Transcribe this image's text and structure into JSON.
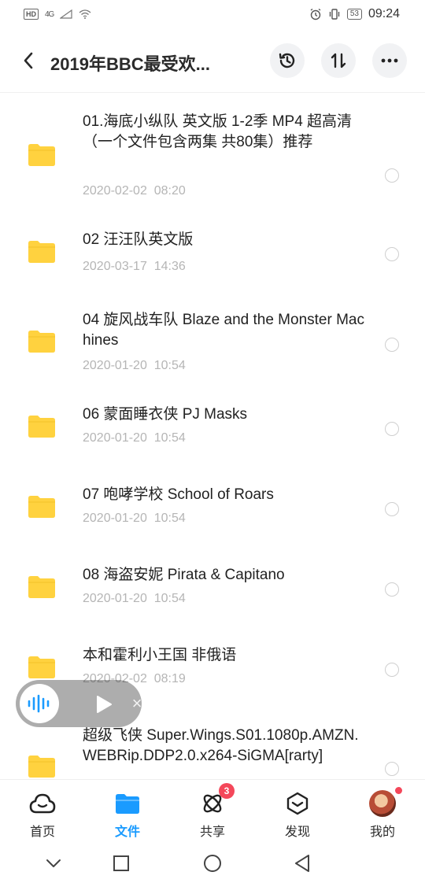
{
  "status_bar": {
    "hd": "HD",
    "net": "4G",
    "time": "09:24",
    "battery": "53",
    "icons": [
      "hd-icon",
      "signal-icon",
      "wifi-icon",
      "alarm-icon",
      "vibrate-icon",
      "battery-icon"
    ]
  },
  "header": {
    "title": "2019年BBC最受欢...",
    "buttons": [
      "history-icon",
      "sort-icon",
      "more-icon"
    ]
  },
  "files": [
    {
      "name": "01.海底小纵队 英文版 1-2季 MP4 超高清（一个文件包含两集 共80集）推荐",
      "date": "2020-02-02  08:20"
    },
    {
      "name": "02 汪汪队英文版",
      "date": "2020-03-17  14:36"
    },
    {
      "name": "04 旋风战车队 Blaze and the Monster Machines",
      "date": "2020-01-20  10:54"
    },
    {
      "name": "06 蒙面睡衣侠 PJ Masks",
      "date": "2020-01-20  10:54"
    },
    {
      "name": "07 咆哮学校 School of Roars",
      "date": "2020-01-20  10:54"
    },
    {
      "name": "08 海盗安妮 Pirata & Capitano",
      "date": "2020-01-20  10:54"
    },
    {
      "name": "本和霍利小王国 非俄语",
      "date": "2020-02-02  08:19"
    },
    {
      "name": "超级飞侠 Super.Wings.S01.1080p.AMZN.WEBRip.DDP2.0.x264-SiGMA[rarty]",
      "date": ""
    }
  ],
  "float_player": {
    "close": "×"
  },
  "bottom_nav": {
    "items": [
      {
        "label": "首页",
        "icon": "home-cloud-icon"
      },
      {
        "label": "文件",
        "icon": "folder-icon"
      },
      {
        "label": "共享",
        "icon": "share-atom-icon",
        "badge": "3"
      },
      {
        "label": "发现",
        "icon": "discover-box-icon"
      },
      {
        "label": "我的",
        "icon": "avatar"
      }
    ]
  },
  "colors": {
    "accent": "#1a9bff",
    "folder": "#ffd23f",
    "badge": "#f4475a",
    "date_text": "#b5b5b5"
  }
}
